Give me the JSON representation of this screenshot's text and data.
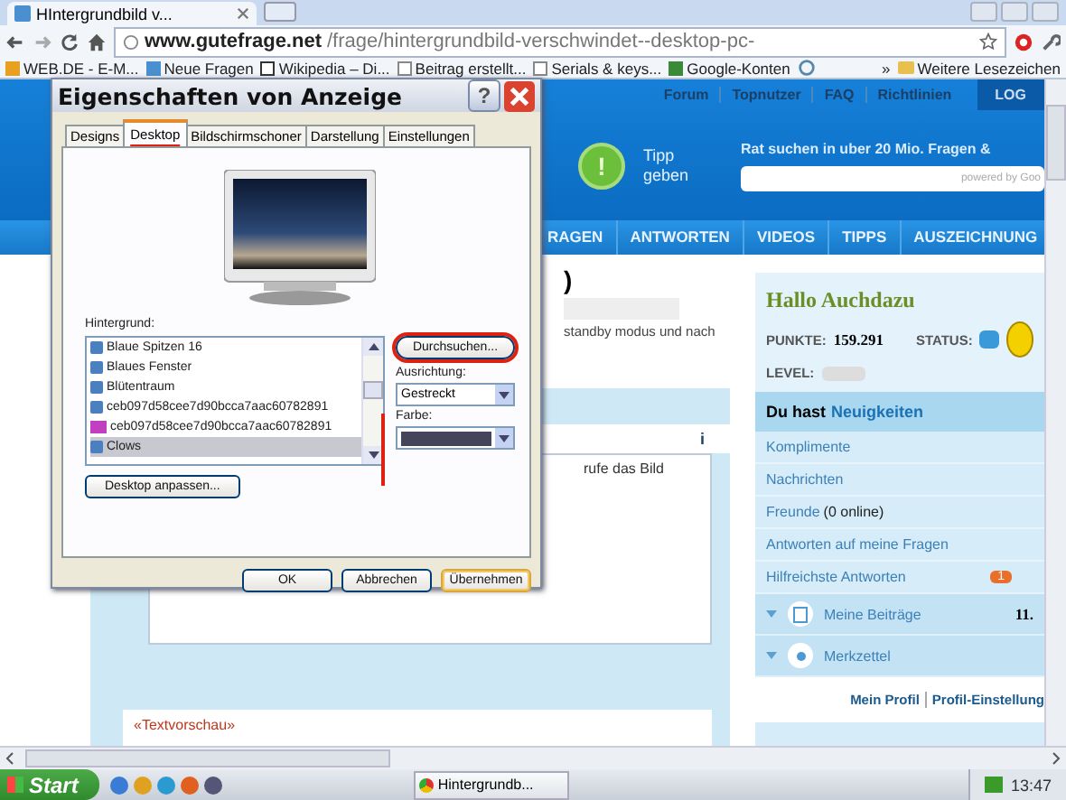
{
  "browser": {
    "tab_title": "HIntergrundbild v...",
    "address_host": "www.gutefrage.net",
    "address_path": "/frage/hintergrundbild-verschwindet--desktop-pc-",
    "bookmarks": [
      {
        "label": "WEB.DE - E-M...",
        "kind": "mail"
      },
      {
        "label": "Neue Fragen",
        "kind": "page"
      },
      {
        "label": "Wikipedia – Di...",
        "kind": "wiki"
      },
      {
        "label": "Beitrag erstellt...",
        "kind": "doc"
      },
      {
        "label": "Serials & keys...",
        "kind": "doc"
      },
      {
        "label": "Google-Konten",
        "kind": "google"
      }
    ],
    "more": "»",
    "other_bookmarks": "Weitere Lesezeichen"
  },
  "header": {
    "top_links": [
      "Forum",
      "Topnutzer",
      "FAQ",
      "Richtlinien"
    ],
    "login": "LOG",
    "tip": "Tipp geben",
    "tip_icon": "!",
    "search_prompt": "Rat suchen in uber 20 Mio. Fragen &",
    "search_brand": "powered by Goo"
  },
  "nav": [
    {
      "label": "RAGEN"
    },
    {
      "label": "ANTWORTEN"
    },
    {
      "label": "VIDEOS"
    },
    {
      "label": "TIPPS"
    },
    {
      "label": "AUSZEICHNUNG"
    }
  ],
  "content": {
    "heading_fragment": ")",
    "text_fragment": "standby modus und nach",
    "toolbar_icon": "i",
    "editor_fragment": "rufe das Bild",
    "preview_label": "«Textvorschau»"
  },
  "sidebar": {
    "greeting": "Hallo Auchdazu",
    "points_label": "PUNKTE:",
    "points": "159.291",
    "status_label": "STATUS:",
    "level_label": "LEVEL:",
    "news_prefix": "Du hast",
    "news_link": "Neuigkeiten",
    "news": [
      {
        "label": "Komplimente"
      },
      {
        "label": "Nachrichten"
      },
      {
        "label": "Freunde",
        "extra": "(0 online)"
      },
      {
        "label": "Antworten auf meine Fragen"
      },
      {
        "label": "Hilfreichste Antworten",
        "badge": "1"
      }
    ],
    "sections": [
      {
        "label": "Meine Beiträge",
        "kind": "posts",
        "value": "11."
      },
      {
        "label": "Merkzettel",
        "kind": "pin"
      }
    ],
    "footer_links": [
      "Mein Profil",
      "Profil-Einstellung"
    ]
  },
  "dialog": {
    "title": "Eigenschaften von Anzeige",
    "help": "?",
    "tabs": [
      {
        "label": "Designs",
        "selected": false
      },
      {
        "label": "Desktop",
        "selected": true
      },
      {
        "label": "Bildschirmschoner",
        "selected": false
      },
      {
        "label": "Darstellung",
        "selected": false
      },
      {
        "label": "Einstellungen",
        "selected": false
      }
    ],
    "background_label": "Hintergrund:",
    "wallpapers": [
      {
        "name": "Blaue Spitzen 16",
        "kind": "image",
        "selected": false
      },
      {
        "name": "Blaues Fenster",
        "kind": "image",
        "selected": false
      },
      {
        "name": "Blütentraum",
        "kind": "image",
        "selected": false
      },
      {
        "name": "ceb097d58cee7d90bcca7aac60782891",
        "kind": "image",
        "selected": false
      },
      {
        "name": "ceb097d58cee7d90bcca7aac60782891",
        "kind": "photoshop",
        "selected": false
      },
      {
        "name": "Clows",
        "kind": "image",
        "selected": true
      }
    ],
    "browse_button": "Durchsuchen...",
    "alignment_label": "Ausrichtung:",
    "alignment_value": "Gestreckt",
    "color_label": "Farbe:",
    "color": "#44445a",
    "customize_button": "Desktop anpassen...",
    "buttons": [
      "OK",
      "Abbrechen",
      "Übernehmen"
    ]
  },
  "taskbar": {
    "start": "Start",
    "window": "Hintergrundb...",
    "clock": "13:47"
  }
}
